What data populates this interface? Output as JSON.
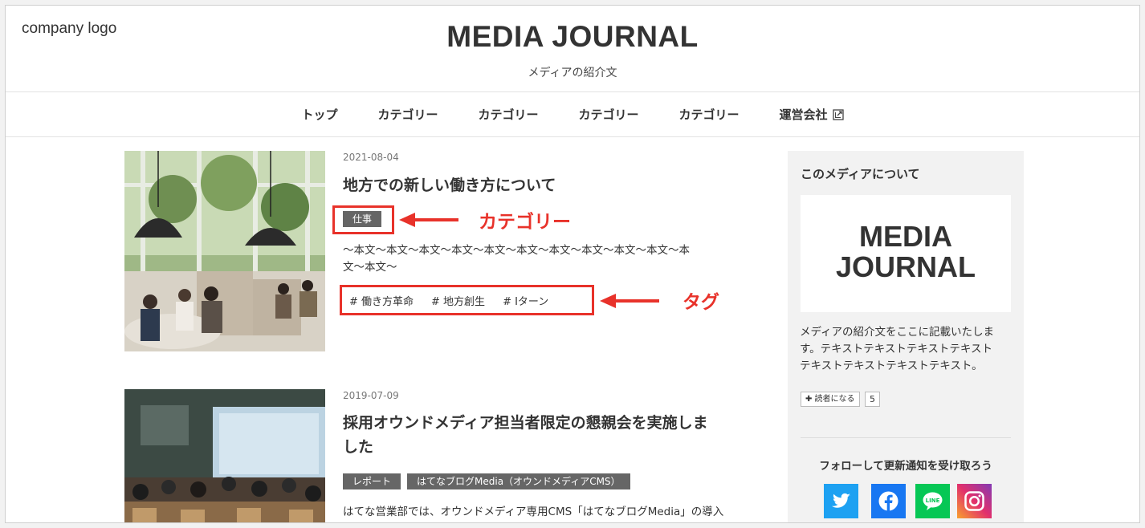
{
  "header": {
    "logo": "company logo",
    "title": "MEDIA JOURNAL",
    "description": "メディアの紹介文"
  },
  "nav": {
    "items": [
      "トップ",
      "カテゴリー",
      "カテゴリー",
      "カテゴリー",
      "カテゴリー",
      "運営会社"
    ]
  },
  "articles": [
    {
      "date": "2021-08-04",
      "title": "地方での新しい働き方について",
      "categories": [
        "仕事"
      ],
      "excerpt_line1": "〜本文〜本文〜本文〜本文〜本文〜本文〜本文〜本文〜本文〜本文〜本",
      "excerpt_line2": "文〜本文〜",
      "tags": [
        "# 働き方革命",
        "# 地方創生",
        "# Iターン"
      ]
    },
    {
      "date": "2019-07-09",
      "title_line1": "採用オウンドメディア担当者限定の懇親会を実施しま",
      "title_line2": "した",
      "categories": [
        "レポート",
        "はてなブログMedia（オウンドメディアCMS）"
      ],
      "excerpt_line1": "はてな営業部では、オウンドメディア専用CMS「はてなブログMedia」の導入"
    }
  ],
  "annotations": {
    "category_label": "カテゴリー",
    "tag_label": "タグ",
    "color": "#e8322a"
  },
  "sidebar": {
    "heading": "このメディアについて",
    "logo_line1": "MEDIA",
    "logo_line2": "JOURNAL",
    "desc_line1": "メディアの紹介文をここに記載いたしま",
    "desc_line2": "す。テキストテキストテキストテキスト",
    "desc_line3": "テキストテキストテキストテキスト。",
    "reader_button": "✚ 読者になる",
    "reader_count": "5",
    "follow_text": "フォローして更新通知を受け取ろう",
    "social": [
      {
        "icon": "twitter-icon",
        "color": "#1da1f2"
      },
      {
        "icon": "facebook-icon",
        "color": "#1877f2"
      },
      {
        "icon": "line-icon",
        "color": "#06c755"
      },
      {
        "icon": "instagram-icon",
        "color": "#c13584"
      }
    ]
  }
}
